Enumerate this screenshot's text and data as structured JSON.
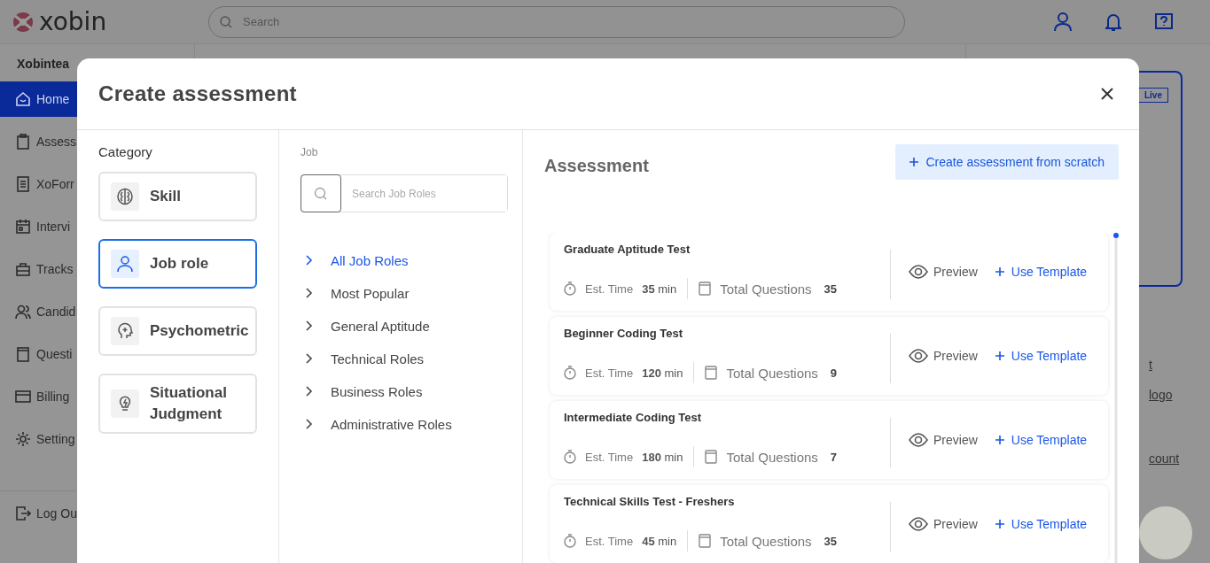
{
  "app": {
    "logo": "xobin",
    "search_placeholder": "Search",
    "org": "Xobintea",
    "nav": [
      {
        "label": "Home",
        "kind": "home",
        "selected": true
      },
      {
        "label": "Assess",
        "kind": "clipboard",
        "selected": false
      },
      {
        "label": "XoForr",
        "kind": "form",
        "selected": false
      },
      {
        "label": "Intervi",
        "kind": "calendar",
        "selected": false
      },
      {
        "label": "Tracks",
        "kind": "briefcase",
        "selected": false
      },
      {
        "label": "Candid",
        "kind": "users",
        "selected": false
      },
      {
        "label": "Questi",
        "kind": "book",
        "selected": false
      },
      {
        "label": "Billing",
        "kind": "card",
        "selected": false
      },
      {
        "label": "Setting",
        "kind": "gear",
        "selected": false
      }
    ],
    "logout": "Log Ou",
    "badge": "Live",
    "links": [
      "t",
      "logo",
      "count"
    ]
  },
  "modal": {
    "title": "Create assessment",
    "category_heading": "Category",
    "categories": [
      {
        "label": "Skill",
        "kind": "brain",
        "selected": false
      },
      {
        "label": "Job role",
        "kind": "person",
        "selected": true
      },
      {
        "label": "Psychometric",
        "kind": "head",
        "selected": false
      },
      {
        "label": "Situational Judgment",
        "kind": "bulb",
        "selected": false
      }
    ],
    "job_heading": "Job",
    "job_search_placeholder": "Search Job Roles",
    "job_roles": [
      {
        "label": "All Job Roles",
        "selected": true
      },
      {
        "label": "Most Popular",
        "selected": false
      },
      {
        "label": "General Aptitude",
        "selected": false
      },
      {
        "label": "Technical Roles",
        "selected": false
      },
      {
        "label": "Business Roles",
        "selected": false
      },
      {
        "label": "Administrative Roles",
        "selected": false
      }
    ],
    "assessment_heading": "Assessment",
    "create_button": "Create assessment from scratch",
    "assessments": [
      {
        "title": "Graduate Aptitude Test",
        "time_label": "Est. Time",
        "time_value": "35",
        "time_unit": "min",
        "questions_label": "Total Questions",
        "questions": "35",
        "preview": "Preview",
        "use_template": "Use Template"
      },
      {
        "title": "Beginner Coding Test",
        "time_label": "Est. Time",
        "time_value": "120",
        "time_unit": "min",
        "questions_label": "Total Questions",
        "questions": "9",
        "preview": "Preview",
        "use_template": "Use Template"
      },
      {
        "title": "Intermediate Coding Test",
        "time_label": "Est. Time",
        "time_value": "180",
        "time_unit": "min",
        "questions_label": "Total Questions",
        "questions": "7",
        "preview": "Preview",
        "use_template": "Use Template"
      },
      {
        "title": "Technical Skills Test - Freshers",
        "time_label": "Est. Time",
        "time_value": "45",
        "time_unit": "min",
        "questions_label": "Total Questions",
        "questions": "35",
        "preview": "Preview",
        "use_template": "Use Template"
      }
    ]
  }
}
